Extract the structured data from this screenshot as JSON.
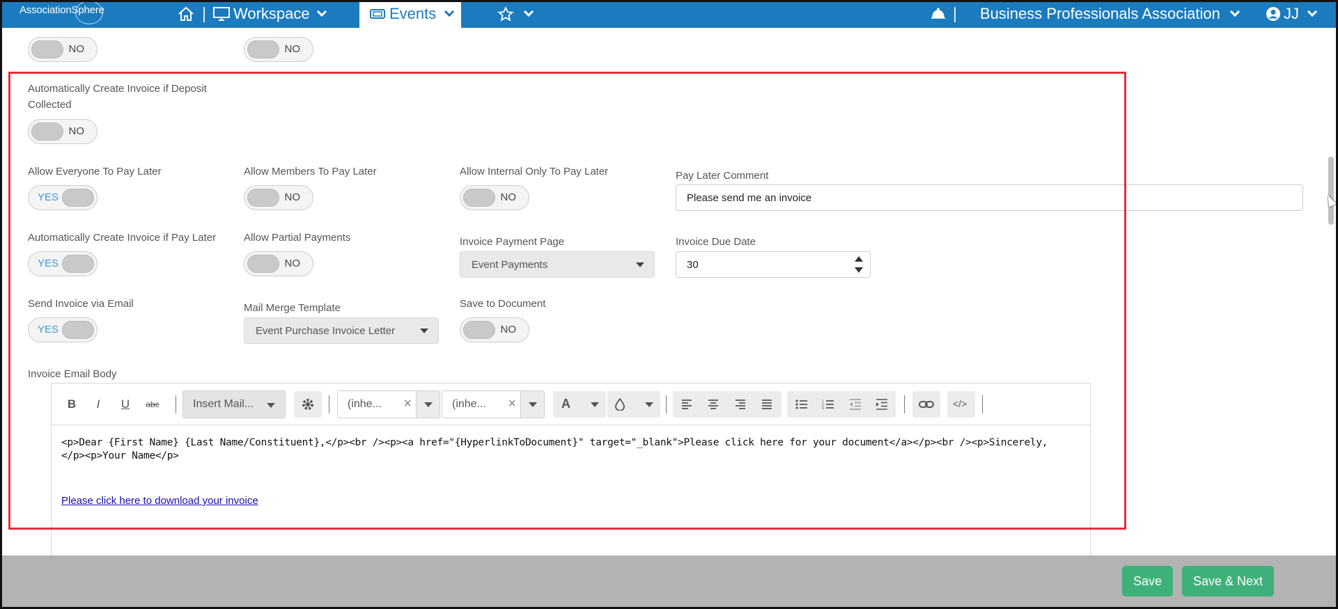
{
  "header": {
    "logo_text": "AssociationSphere",
    "workspace_label": "Workspace",
    "events_label": "Events",
    "org_name": "Business Professionals Association",
    "user_initials": "JJ"
  },
  "form": {
    "top_toggle_1": "NO",
    "top_toggle_2": "NO",
    "auto_create_deposit": {
      "label": "Automatically Create Invoice if Deposit Collected",
      "value": "NO"
    },
    "allow_everyone_pay_later": {
      "label": "Allow Everyone To Pay Later",
      "value": "YES"
    },
    "allow_members_pay_later": {
      "label": "Allow Members To Pay Later",
      "value": "NO"
    },
    "allow_internal_pay_later": {
      "label": "Allow Internal Only To Pay Later",
      "value": "NO"
    },
    "pay_later_comment": {
      "label": "Pay Later Comment",
      "value": "Please send me an invoice"
    },
    "auto_create_pay_later": {
      "label": "Automatically Create Invoice if Pay Later",
      "value": "YES"
    },
    "allow_partial_payments": {
      "label": "Allow Partial Payments",
      "value": "NO"
    },
    "invoice_payment_page": {
      "label": "Invoice Payment Page",
      "value": "Event Payments"
    },
    "invoice_due_date": {
      "label": "Invoice Due Date",
      "value": "30"
    },
    "send_invoice_email": {
      "label": "Send Invoice via Email",
      "value": "YES"
    },
    "mail_merge_template": {
      "label": "Mail Merge Template",
      "value": "Event Purchase Invoice Letter"
    },
    "save_to_document": {
      "label": "Save to Document",
      "value": "NO"
    },
    "invoice_email_body": {
      "label": "Invoice Email Body"
    }
  },
  "editor": {
    "toolbar": {
      "bold": "B",
      "italic": "I",
      "underline": "U",
      "strike": "abc",
      "insert_mail": "Insert Mail...",
      "font_family": "(inhe...",
      "font_size": "(inhe...",
      "font_color": "A",
      "html_code": "</>"
    },
    "body_line_1": "<p>Dear {First Name} {Last Name/Constituent},</p><br /><p><a href=\"{HyperlinkToDocument}\" target=\"_blank\">Please click here for your document</a></p><br /><p>Sincerely,",
    "body_line_2": "</p><p>Your Name</p>",
    "download_link": "Please click here to download your invoice"
  },
  "footer": {
    "save_label": "Save",
    "save_next_label": "Save & Next"
  },
  "colors": {
    "nav_blue": "#1a7bbf",
    "highlight_red": "#e0303a",
    "button_green": "#3eb17a",
    "toggle_yes_blue": "#3a9ad9"
  }
}
